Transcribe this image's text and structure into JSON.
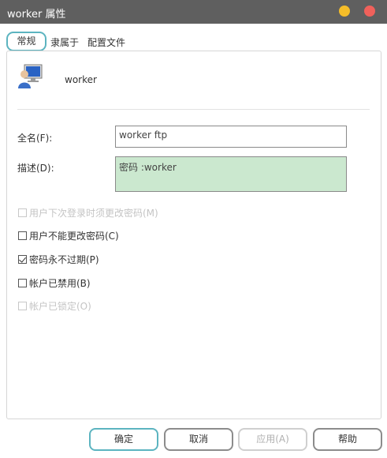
{
  "window": {
    "title": "worker 属性"
  },
  "tabs": {
    "general": "常规",
    "member_of": "隶属于",
    "profile": "配置文件"
  },
  "user": {
    "name": "worker",
    "icon": "user-computer-icon"
  },
  "fields": {
    "fullname_label": "全名(F):",
    "fullname_value": "worker ftp",
    "description_label": "描述(D):",
    "description_value": "密码 :worker"
  },
  "checkboxes": [
    {
      "label": "用户下次登录时须更改密码(M)",
      "checked": false,
      "disabled": true
    },
    {
      "label": "用户不能更改密码(C)",
      "checked": false,
      "disabled": false
    },
    {
      "label": "密码永不过期(P)",
      "checked": true,
      "disabled": false
    },
    {
      "label": "帐户已禁用(B)",
      "checked": false,
      "disabled": false
    },
    {
      "label": "帐户已锁定(O)",
      "checked": false,
      "disabled": true
    }
  ],
  "buttons": {
    "ok": "确定",
    "cancel": "取消",
    "apply": "应用(A)",
    "help": "帮助"
  },
  "colors": {
    "titlebar": "#5f5f5f",
    "accent": "#5cb4c0",
    "minimize": "#f5bd29",
    "close": "#f0615b",
    "description_bg": "#cbe8cf"
  }
}
